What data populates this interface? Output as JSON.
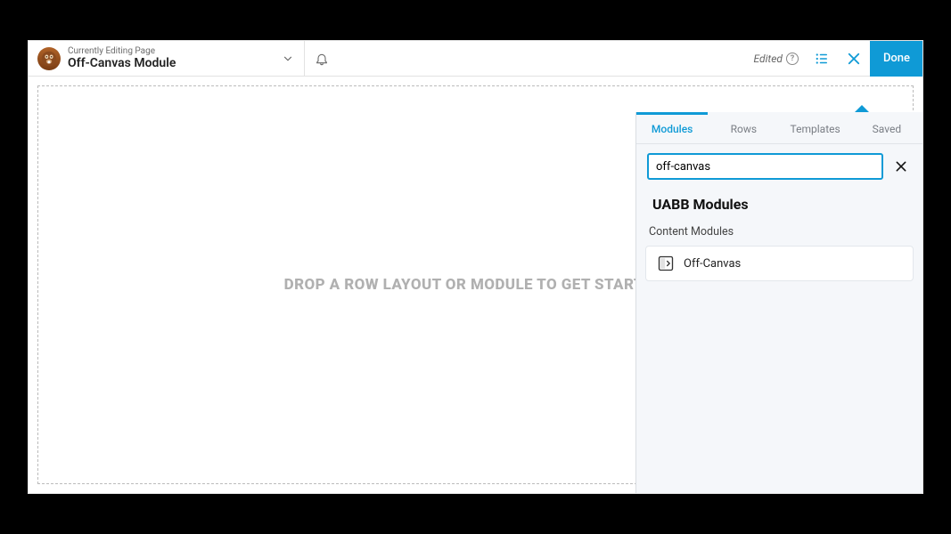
{
  "header": {
    "sub": "Currently Editing Page",
    "title": "Off-Canvas Module",
    "edited_label": "Edited",
    "done_label": "Done"
  },
  "canvas": {
    "drop_text": "DROP A ROW LAYOUT OR MODULE TO GET STARTED!"
  },
  "panel": {
    "tabs": {
      "modules": "Modules",
      "rows": "Rows",
      "templates": "Templates",
      "saved": "Saved"
    },
    "active_tab": "modules",
    "search_value": "off-canvas",
    "section_title": "UABB Modules",
    "group_label": "Content Modules",
    "items": [
      {
        "label": "Off-Canvas"
      }
    ]
  }
}
